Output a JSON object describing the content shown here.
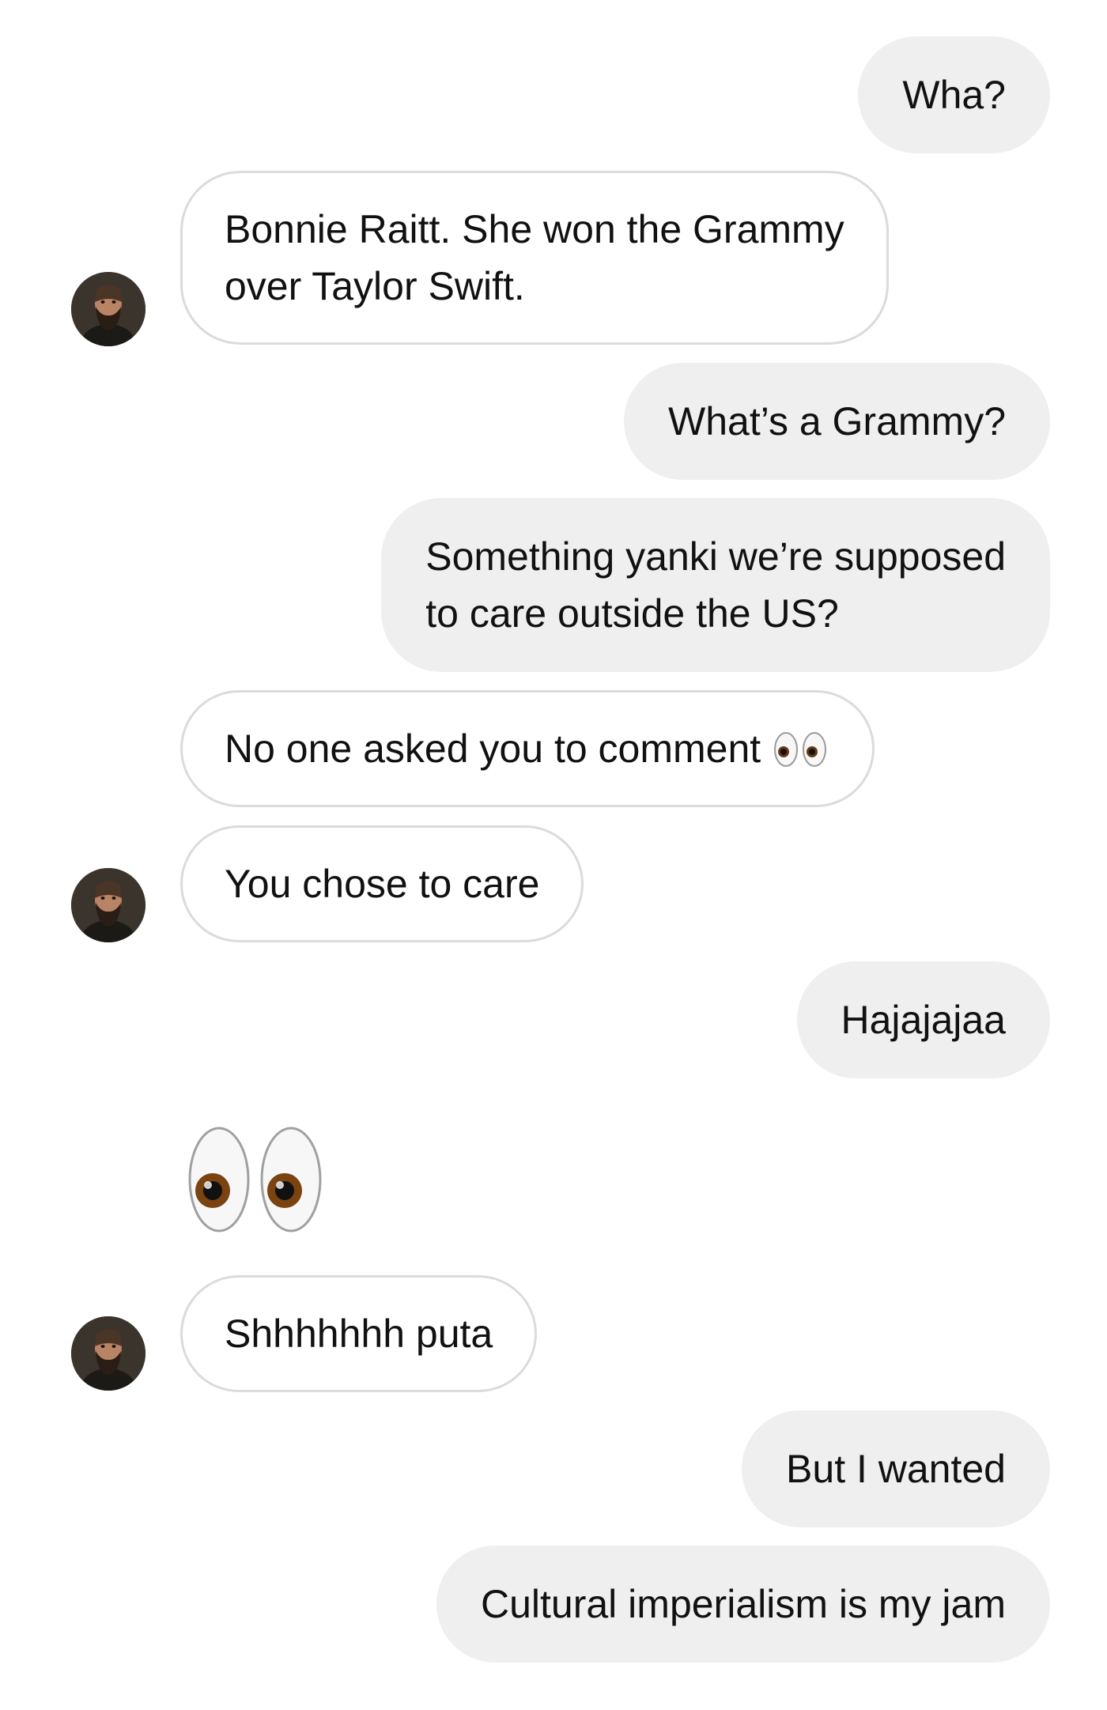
{
  "messages": [
    {
      "id": 1,
      "from": "me",
      "text": "Wha?"
    },
    {
      "id": 2,
      "from": "them",
      "lines": [
        "Bonnie Raitt. She won the Grammy",
        "over Taylor Swift."
      ]
    },
    {
      "id": 3,
      "from": "me",
      "text": "What’s a Grammy?"
    },
    {
      "id": 4,
      "from": "me",
      "lines": [
        "Something yanki we’re supposed",
        "to care outside the US?"
      ]
    },
    {
      "id": 5,
      "from": "them",
      "text": "No one asked you to comment",
      "emoji": "eyes-emoji"
    },
    {
      "id": 6,
      "from": "them",
      "text": "You chose to care"
    },
    {
      "id": 7,
      "from": "me",
      "text": "Hajajajaa"
    },
    {
      "id": 8,
      "from": "them",
      "emoji": "eyes-emoji"
    },
    {
      "id": 9,
      "from": "them",
      "text": "Shhhhhhh puta"
    },
    {
      "id": 10,
      "from": "me",
      "text": "But I wanted"
    },
    {
      "id": 11,
      "from": "me",
      "text": "Cultural imperialism is my jam"
    }
  ],
  "colors": {
    "sent_bubble": "#efefef",
    "recv_bubble": "#ffffff",
    "recv_border": "#dbdbdb",
    "text": "#111111"
  }
}
